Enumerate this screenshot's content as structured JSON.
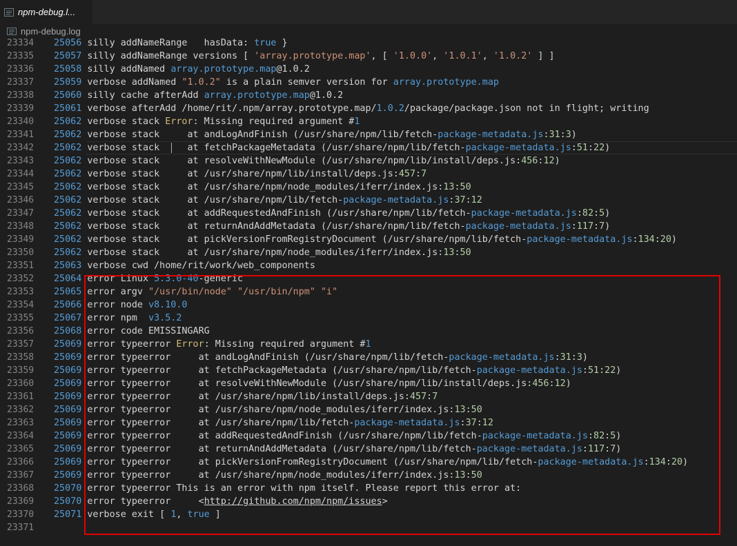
{
  "tab": {
    "label": "npm-debug.l...",
    "icon": "file-lines-icon"
  },
  "breadcrumb": {
    "label": "npm-debug.log",
    "icon": "file-lines-icon"
  },
  "colors": {
    "error_box": "#e60000",
    "background": "#1e1e1e",
    "line_number": "#858585"
  },
  "lines": [
    {
      "n": "23334",
      "s": [
        [
          "num",
          "25056"
        ],
        [
          "def",
          " silly addNameRange   hasData: "
        ],
        [
          "kw",
          "true"
        ],
        [
          "def",
          " }"
        ]
      ]
    },
    {
      "n": "23335",
      "s": [
        [
          "num",
          "25057"
        ],
        [
          "def",
          " silly addNameRange versions [ "
        ],
        [
          "str",
          "'array.prototype.map'"
        ],
        [
          "def",
          ", [ "
        ],
        [
          "str",
          "'1.0.0'"
        ],
        [
          "def",
          ", "
        ],
        [
          "str",
          "'1.0.1'"
        ],
        [
          "def",
          ", "
        ],
        [
          "str",
          "'1.0.2'"
        ],
        [
          "def",
          " ] ]"
        ]
      ]
    },
    {
      "n": "23336",
      "s": [
        [
          "num",
          "25058"
        ],
        [
          "def",
          " silly addNamed "
        ],
        [
          "path",
          "array.prototype.map"
        ],
        [
          "def",
          "@1.0.2"
        ]
      ]
    },
    {
      "n": "23337",
      "s": [
        [
          "num",
          "25059"
        ],
        [
          "def",
          " verbose addNamed "
        ],
        [
          "str",
          "\"1.0.2\""
        ],
        [
          "def",
          " is a plain semver version for "
        ],
        [
          "path",
          "array.prototype.map"
        ]
      ]
    },
    {
      "n": "23338",
      "s": [
        [
          "num",
          "25060"
        ],
        [
          "def",
          " silly cache afterAdd "
        ],
        [
          "path",
          "array.prototype.map"
        ],
        [
          "def",
          "@1.0.2"
        ]
      ]
    },
    {
      "n": "23339",
      "s": [
        [
          "num",
          "25061"
        ],
        [
          "def",
          " verbose afterAdd /home/rit/.npm/array.prototype.map/"
        ],
        [
          "path",
          "1.0.2"
        ],
        [
          "def",
          "/package/package.json not in flight; writing"
        ]
      ]
    },
    {
      "n": "23340",
      "s": [
        [
          "num",
          "25062"
        ],
        [
          "def",
          " verbose stack "
        ],
        [
          "err",
          "Error"
        ],
        [
          "def",
          ": Missing required argument #"
        ],
        [
          "num",
          "1"
        ]
      ]
    },
    {
      "n": "23341",
      "s": [
        [
          "num",
          "25062"
        ],
        [
          "def",
          " verbose stack     at andLogAndFinish (/usr/share/npm/lib/fetch-"
        ],
        [
          "path",
          "package-metadata.js"
        ],
        [
          "def",
          ":"
        ],
        [
          "loc",
          "31"
        ],
        [
          "def",
          ":"
        ],
        [
          "loc",
          "3"
        ],
        [
          "def",
          ")"
        ]
      ]
    },
    {
      "n": "23342",
      "cur": true,
      "s": [
        [
          "num",
          "25062"
        ],
        [
          "def",
          " verbose stack     at fetchPackageMetadata (/usr/share/npm/lib/fetch-"
        ],
        [
          "path",
          "package-metadata.js"
        ],
        [
          "def",
          ":"
        ],
        [
          "loc",
          "51"
        ],
        [
          "def",
          ":"
        ],
        [
          "loc",
          "22"
        ],
        [
          "def",
          ")"
        ]
      ]
    },
    {
      "n": "23343",
      "s": [
        [
          "num",
          "25062"
        ],
        [
          "def",
          " verbose stack     at resolveWithNewModule (/usr/share/npm/lib/install/deps.js:"
        ],
        [
          "loc",
          "456"
        ],
        [
          "def",
          ":"
        ],
        [
          "loc",
          "12"
        ],
        [
          "def",
          ")"
        ]
      ]
    },
    {
      "n": "23344",
      "s": [
        [
          "num",
          "25062"
        ],
        [
          "def",
          " verbose stack     at /usr/share/npm/lib/install/deps.js:"
        ],
        [
          "loc",
          "457"
        ],
        [
          "def",
          ":"
        ],
        [
          "loc",
          "7"
        ]
      ]
    },
    {
      "n": "23345",
      "s": [
        [
          "num",
          "25062"
        ],
        [
          "def",
          " verbose stack     at /usr/share/npm/node_modules/iferr/index.js:"
        ],
        [
          "loc",
          "13"
        ],
        [
          "def",
          ":"
        ],
        [
          "loc",
          "50"
        ]
      ]
    },
    {
      "n": "23346",
      "s": [
        [
          "num",
          "25062"
        ],
        [
          "def",
          " verbose stack     at /usr/share/npm/lib/fetch-"
        ],
        [
          "path",
          "package-metadata.js"
        ],
        [
          "def",
          ":"
        ],
        [
          "loc",
          "37"
        ],
        [
          "def",
          ":"
        ],
        [
          "loc",
          "12"
        ]
      ]
    },
    {
      "n": "23347",
      "s": [
        [
          "num",
          "25062"
        ],
        [
          "def",
          " verbose stack     at addRequestedAndFinish (/usr/share/npm/lib/fetch-"
        ],
        [
          "path",
          "package-metadata.js"
        ],
        [
          "def",
          ":"
        ],
        [
          "loc",
          "82"
        ],
        [
          "def",
          ":"
        ],
        [
          "loc",
          "5"
        ],
        [
          "def",
          ")"
        ]
      ]
    },
    {
      "n": "23348",
      "s": [
        [
          "num",
          "25062"
        ],
        [
          "def",
          " verbose stack     at returnAndAddMetadata (/usr/share/npm/lib/fetch-"
        ],
        [
          "path",
          "package-metadata.js"
        ],
        [
          "def",
          ":"
        ],
        [
          "loc",
          "117"
        ],
        [
          "def",
          ":"
        ],
        [
          "loc",
          "7"
        ],
        [
          "def",
          ")"
        ]
      ]
    },
    {
      "n": "23349",
      "s": [
        [
          "num",
          "25062"
        ],
        [
          "def",
          " verbose stack     at pickVersionFromRegistryDocument (/usr/share/npm/lib/fetch-"
        ],
        [
          "path",
          "package-metadata.js"
        ],
        [
          "def",
          ":"
        ],
        [
          "loc",
          "134"
        ],
        [
          "def",
          ":"
        ],
        [
          "loc",
          "20"
        ],
        [
          "def",
          ")"
        ]
      ]
    },
    {
      "n": "23350",
      "s": [
        [
          "num",
          "25062"
        ],
        [
          "def",
          " verbose stack     at /usr/share/npm/node_modules/iferr/index.js:"
        ],
        [
          "loc",
          "13"
        ],
        [
          "def",
          ":"
        ],
        [
          "loc",
          "50"
        ]
      ]
    },
    {
      "n": "23351",
      "s": [
        [
          "num",
          "25063"
        ],
        [
          "def",
          " verbose cwd /home/rit/work/web_components"
        ]
      ]
    },
    {
      "n": "23352",
      "s": [
        [
          "num",
          "25064"
        ],
        [
          "def",
          " error Linux "
        ],
        [
          "num",
          "5.3.0-40"
        ],
        [
          "def",
          "-generic"
        ]
      ]
    },
    {
      "n": "23353",
      "s": [
        [
          "num",
          "25065"
        ],
        [
          "def",
          " error argv "
        ],
        [
          "str",
          "\"/usr/bin/node\""
        ],
        [
          "def",
          " "
        ],
        [
          "str",
          "\"/usr/bin/npm\""
        ],
        [
          "def",
          " "
        ],
        [
          "str",
          "\"i\""
        ]
      ]
    },
    {
      "n": "23354",
      "s": [
        [
          "num",
          "25066"
        ],
        [
          "def",
          " error node "
        ],
        [
          "num",
          "v8.10.0"
        ]
      ]
    },
    {
      "n": "23355",
      "s": [
        [
          "num",
          "25067"
        ],
        [
          "def",
          " error npm  "
        ],
        [
          "num",
          "v3.5.2"
        ]
      ]
    },
    {
      "n": "23356",
      "s": [
        [
          "num",
          "25068"
        ],
        [
          "def",
          " error code EMISSINGARG"
        ]
      ]
    },
    {
      "n": "23357",
      "s": [
        [
          "num",
          "25069"
        ],
        [
          "def",
          " error typeerror "
        ],
        [
          "err",
          "Error"
        ],
        [
          "def",
          ": Missing required argument #"
        ],
        [
          "num",
          "1"
        ]
      ]
    },
    {
      "n": "23358",
      "s": [
        [
          "num",
          "25069"
        ],
        [
          "def",
          " error typeerror     at andLogAndFinish (/usr/share/npm/lib/fetch-"
        ],
        [
          "path",
          "package-metadata.js"
        ],
        [
          "def",
          ":"
        ],
        [
          "loc",
          "31"
        ],
        [
          "def",
          ":"
        ],
        [
          "loc",
          "3"
        ],
        [
          "def",
          ")"
        ]
      ]
    },
    {
      "n": "23359",
      "s": [
        [
          "num",
          "25069"
        ],
        [
          "def",
          " error typeerror     at fetchPackageMetadata (/usr/share/npm/lib/fetch-"
        ],
        [
          "path",
          "package-metadata.js"
        ],
        [
          "def",
          ":"
        ],
        [
          "loc",
          "51"
        ],
        [
          "def",
          ":"
        ],
        [
          "loc",
          "22"
        ],
        [
          "def",
          ")"
        ]
      ]
    },
    {
      "n": "23360",
      "s": [
        [
          "num",
          "25069"
        ],
        [
          "def",
          " error typeerror     at resolveWithNewModule (/usr/share/npm/lib/install/deps.js:"
        ],
        [
          "loc",
          "456"
        ],
        [
          "def",
          ":"
        ],
        [
          "loc",
          "12"
        ],
        [
          "def",
          ")"
        ]
      ]
    },
    {
      "n": "23361",
      "s": [
        [
          "num",
          "25069"
        ],
        [
          "def",
          " error typeerror     at /usr/share/npm/lib/install/deps.js:"
        ],
        [
          "loc",
          "457"
        ],
        [
          "def",
          ":"
        ],
        [
          "loc",
          "7"
        ]
      ]
    },
    {
      "n": "23362",
      "s": [
        [
          "num",
          "25069"
        ],
        [
          "def",
          " error typeerror     at /usr/share/npm/node_modules/iferr/index.js:"
        ],
        [
          "loc",
          "13"
        ],
        [
          "def",
          ":"
        ],
        [
          "loc",
          "50"
        ]
      ]
    },
    {
      "n": "23363",
      "s": [
        [
          "num",
          "25069"
        ],
        [
          "def",
          " error typeerror     at /usr/share/npm/lib/fetch-"
        ],
        [
          "path",
          "package-metadata.js"
        ],
        [
          "def",
          ":"
        ],
        [
          "loc",
          "37"
        ],
        [
          "def",
          ":"
        ],
        [
          "loc",
          "12"
        ]
      ]
    },
    {
      "n": "23364",
      "s": [
        [
          "num",
          "25069"
        ],
        [
          "def",
          " error typeerror     at addRequestedAndFinish (/usr/share/npm/lib/fetch-"
        ],
        [
          "path",
          "package-metadata.js"
        ],
        [
          "def",
          ":"
        ],
        [
          "loc",
          "82"
        ],
        [
          "def",
          ":"
        ],
        [
          "loc",
          "5"
        ],
        [
          "def",
          ")"
        ]
      ]
    },
    {
      "n": "23365",
      "s": [
        [
          "num",
          "25069"
        ],
        [
          "def",
          " error typeerror     at returnAndAddMetadata (/usr/share/npm/lib/fetch-"
        ],
        [
          "path",
          "package-metadata.js"
        ],
        [
          "def",
          ":"
        ],
        [
          "loc",
          "117"
        ],
        [
          "def",
          ":"
        ],
        [
          "loc",
          "7"
        ],
        [
          "def",
          ")"
        ]
      ]
    },
    {
      "n": "23366",
      "s": [
        [
          "num",
          "25069"
        ],
        [
          "def",
          " error typeerror     at pickVersionFromRegistryDocument (/usr/share/npm/lib/fetch-"
        ],
        [
          "path",
          "package-metadata.js"
        ],
        [
          "def",
          ":"
        ],
        [
          "loc",
          "134"
        ],
        [
          "def",
          ":"
        ],
        [
          "loc",
          "20"
        ],
        [
          "def",
          ")"
        ]
      ]
    },
    {
      "n": "23367",
      "s": [
        [
          "num",
          "25069"
        ],
        [
          "def",
          " error typeerror     at /usr/share/npm/node_modules/iferr/index.js:"
        ],
        [
          "loc",
          "13"
        ],
        [
          "def",
          ":"
        ],
        [
          "loc",
          "50"
        ]
      ]
    },
    {
      "n": "23368",
      "s": [
        [
          "num",
          "25070"
        ],
        [
          "def",
          " error typeerror This is an error with npm itself. Please report this error at:"
        ]
      ]
    },
    {
      "n": "23369",
      "s": [
        [
          "num",
          "25070"
        ],
        [
          "def",
          " error typeerror     <"
        ],
        [
          "link",
          "http://github.com/npm/npm/issues"
        ],
        [
          "def",
          ">"
        ]
      ]
    },
    {
      "n": "23370",
      "s": [
        [
          "num",
          "25071"
        ],
        [
          "def",
          " verbose exit [ "
        ],
        [
          "num",
          "1"
        ],
        [
          "def",
          ", "
        ],
        [
          "kw",
          "true"
        ],
        [
          "def",
          " ]"
        ]
      ]
    },
    {
      "n": "23371",
      "s": []
    }
  ]
}
